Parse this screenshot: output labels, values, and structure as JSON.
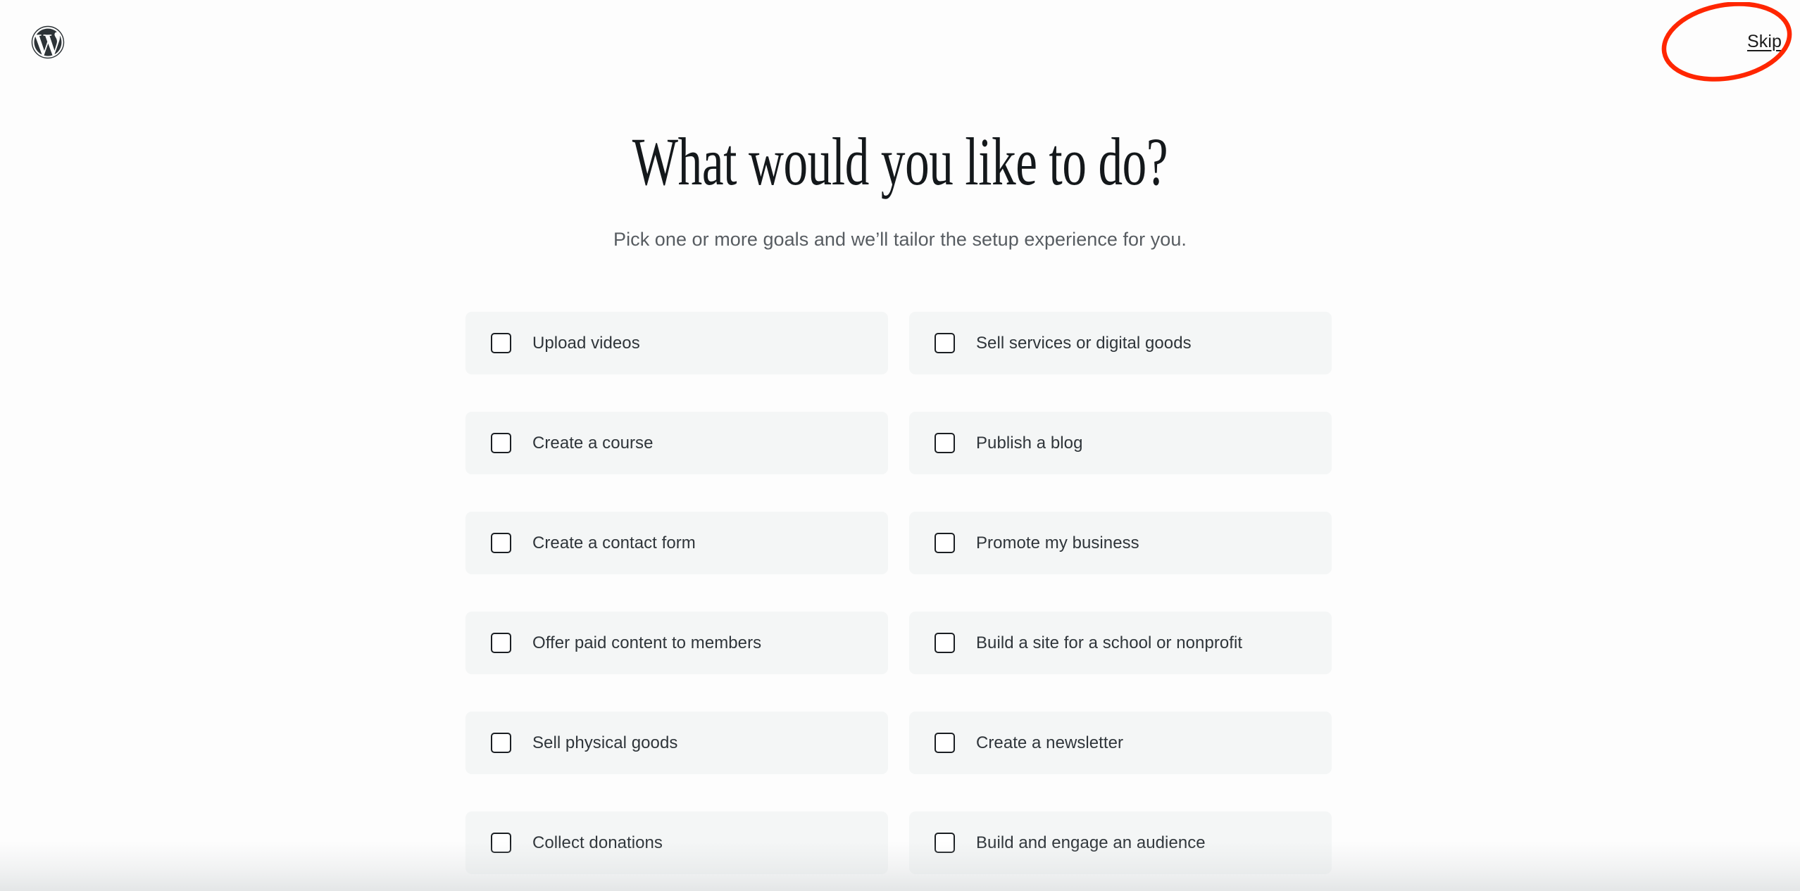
{
  "brand": {
    "logo_icon": "wordpress-logo-icon",
    "logo_color": "#2d3337"
  },
  "header": {
    "skip_label": "Skip"
  },
  "annotation": {
    "shape": "ellipse",
    "color": "#ff2600",
    "target": "Skip"
  },
  "main": {
    "title": "What would you like to do?",
    "subtitle": "Pick one or more goals and we’ll tailor the setup experience for you."
  },
  "goals": [
    {
      "label": "Upload videos",
      "checked": false
    },
    {
      "label": "Sell services or digital goods",
      "checked": false
    },
    {
      "label": "Create a course",
      "checked": false
    },
    {
      "label": "Publish a blog",
      "checked": false
    },
    {
      "label": "Create a contact form",
      "checked": false
    },
    {
      "label": "Promote my business",
      "checked": false
    },
    {
      "label": "Offer paid content to members",
      "checked": false
    },
    {
      "label": "Build a site for a school or nonprofit",
      "checked": false
    },
    {
      "label": "Sell physical goods",
      "checked": false
    },
    {
      "label": "Create a newsletter",
      "checked": false
    },
    {
      "label": "Collect donations",
      "checked": false
    },
    {
      "label": "Build and engage an audience",
      "checked": false
    }
  ],
  "colors": {
    "background": "#fdfdfd",
    "card_background": "#f4f6f6",
    "text_primary": "#14181b",
    "text_secondary": "#575c61",
    "checkbox_border": "#1b1f23",
    "annotation_red": "#ff2600"
  }
}
